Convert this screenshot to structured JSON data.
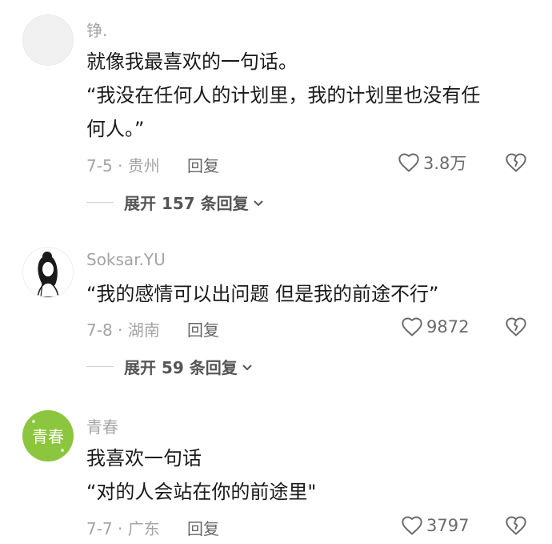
{
  "comments": [
    {
      "username": "铮.",
      "lines": [
        "就像我最喜欢的一句话。",
        "“我没在任何人的计划里，我的计划里也没有任",
        "何人。”"
      ],
      "meta": "7-5 · 贵州",
      "reply_label": "回复",
      "likes": "3.8万",
      "expand_label": "展开 157 条回复",
      "avatar_icon": "blank-avatar"
    },
    {
      "username": "Soksar.YU",
      "lines": [
        "“我的感情可以出问题 但是我的前途不行”"
      ],
      "meta": "7-8 · 湖南",
      "reply_label": "回复",
      "likes": "9872",
      "expand_label": "展开 59 条回复",
      "avatar_icon": "sketch-girl-avatar"
    },
    {
      "username": "青春",
      "lines": [
        "我喜欢一句话",
        "“对的人会站在你的前途里\""
      ],
      "meta": "7-7 · 广东",
      "reply_label": "回复",
      "likes": "3797",
      "avatar_icon": "qingchun-green-avatar",
      "avatar_text": "青春"
    }
  ],
  "colors": {
    "text_primary": "#1a1a1a",
    "text_secondary": "#a4a4a4",
    "avatar_green": "#8cc63f"
  }
}
